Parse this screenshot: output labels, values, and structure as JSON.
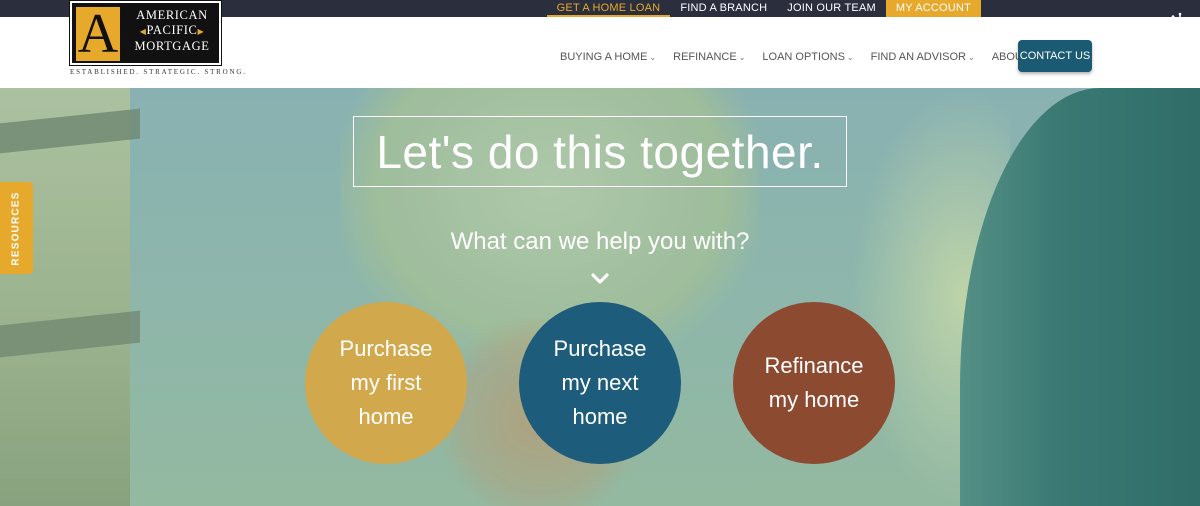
{
  "topnav": {
    "items": [
      "GET A HOME LOAN",
      "FIND A BRANCH",
      "JOIN OUR TEAM",
      "MY ACCOUNT"
    ]
  },
  "logo": {
    "line1": "AMERICAN",
    "line2": "PACIFIC",
    "line3": "MORTGAGE",
    "tagline": "ESTABLISHED. STRATEGIC. STRONG."
  },
  "mainnav": {
    "items": [
      "BUYING A HOME",
      "REFINANCE",
      "LOAN OPTIONS",
      "FIND AN ADVISOR",
      "ABOUT"
    ]
  },
  "contact_label": "CONTACT US",
  "hero": {
    "headline": "Let's do this together.",
    "subhead": "What can we help you with?",
    "options": [
      {
        "label": "Purchase my first home",
        "color": "#d1a84b"
      },
      {
        "label": "Purchase my next home",
        "color": "#1d5c7a"
      },
      {
        "label": "Refinance my home",
        "color": "#8c4a31"
      }
    ]
  },
  "resources_label": "RESOURCES",
  "colors": {
    "accent": "#e7a92c",
    "topbar": "#2a2e3d",
    "contact": "#1a5a73"
  }
}
